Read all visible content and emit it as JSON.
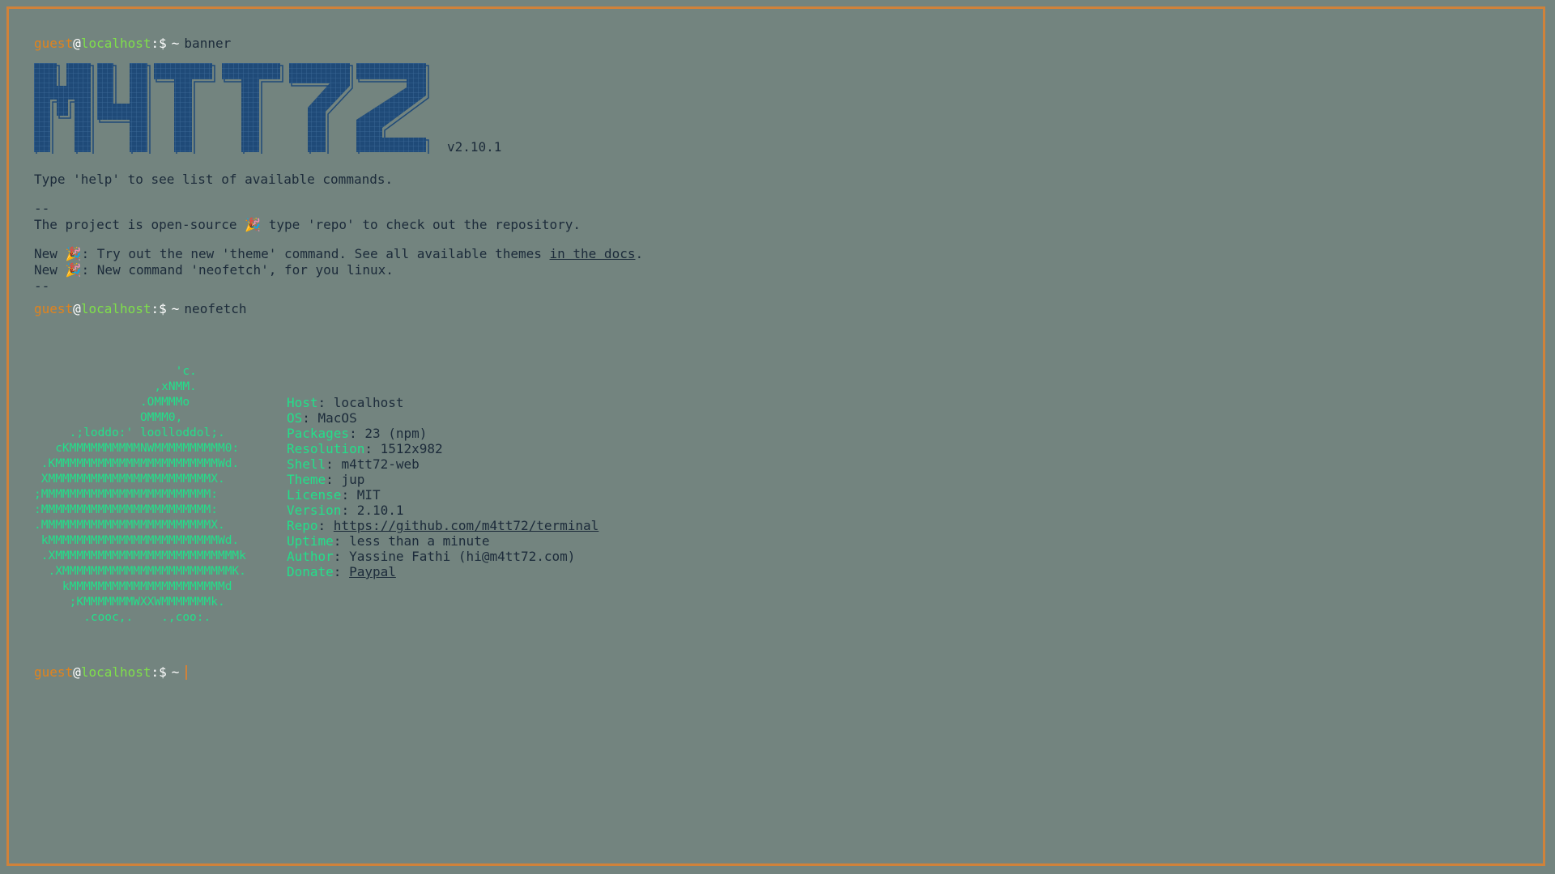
{
  "prompt": {
    "user": "guest",
    "at": "@",
    "host": "localhost",
    "sep": ":$",
    "tilde": "~"
  },
  "commands": {
    "first": "banner",
    "second": "neofetch"
  },
  "banner": {
    "logo_text": "M4TT72",
    "version": "v2.10.1"
  },
  "messages": {
    "help": "Type 'help' to see list of available commands.",
    "dash": "--",
    "opensource_pre": "The project is open-source ",
    "opensource_post": " type 'repo' to check out the repository.",
    "new_label": "New ",
    "news1_pre": ": Try out the new 'theme' command. See all available themes ",
    "news1_link": "in the docs",
    "news1_post": ".",
    "news2": ": New command 'neofetch', for you linux."
  },
  "neofetch": {
    "logo": [
      "                    'c.",
      "                 ,xNMM.",
      "               .OMMMMo",
      "               OMMM0,",
      "     .;loddo:' loolloddol;.",
      "   cKMMMMMMMMMMNWMMMMMMMMMM0:",
      " .KMMMMMMMMMMMMMMMMMMMMMMMWd.",
      " XMMMMMMMMMMMMMMMMMMMMMMMX.",
      ";MMMMMMMMMMMMMMMMMMMMMMMM:",
      ":MMMMMMMMMMMMMMMMMMMMMMMM:",
      ".MMMMMMMMMMMMMMMMMMMMMMMMX.",
      " kMMMMMMMMMMMMMMMMMMMMMMMMWd.",
      " .XMMMMMMMMMMMMMMMMMMMMMMMMMMk",
      "  .XMMMMMMMMMMMMMMMMMMMMMMMMK.",
      "    kMMMMMMMMMMMMMMMMMMMMMMd",
      "     ;KMMMMMMMWXXWMMMMMMMk.",
      "       .cooc,.    .,coo:."
    ],
    "info": [
      {
        "key": "Host",
        "value": "localhost",
        "link": false
      },
      {
        "key": "OS",
        "value": "MacOS",
        "link": false
      },
      {
        "key": "Packages",
        "value": "23 (npm)",
        "link": false
      },
      {
        "key": "Resolution",
        "value": "1512x982",
        "link": false
      },
      {
        "key": "Shell",
        "value": "m4tt72-web",
        "link": false
      },
      {
        "key": "Theme",
        "value": "jup",
        "link": false
      },
      {
        "key": "License",
        "value": "MIT",
        "link": false
      },
      {
        "key": "Version",
        "value": "2.10.1",
        "link": false
      },
      {
        "key": "Repo",
        "value": "https://github.com/m4tt72/terminal",
        "link": true
      },
      {
        "key": "Uptime",
        "value": "less than a minute",
        "link": false
      },
      {
        "key": "Author",
        "value": "Yassine Fathi (hi@m4tt72.com)",
        "link": false
      },
      {
        "key": "Donate",
        "value": "Paypal",
        "link": true
      }
    ]
  },
  "colors": {
    "background": "#73847f",
    "border": "#d0823a",
    "user": "#e2831c",
    "host": "#7fe04a",
    "accent_green": "#22e08a",
    "banner_blue": "#1f4a78"
  },
  "icons": {
    "party": "party-popper-icon"
  }
}
